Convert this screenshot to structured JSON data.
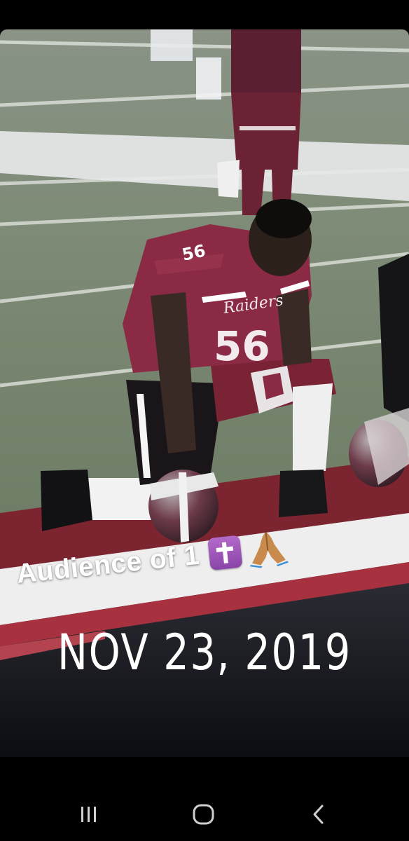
{
  "story": {
    "caption": "Audience of 1",
    "caption_emojis": [
      "latin-cross-emoji",
      "folded-hands-emoji"
    ],
    "date_sticker": "NOV 23, 2019",
    "photo": {
      "subject": "football-player-kneeling",
      "jersey_number": "56",
      "jersey_color": "#8a2a45"
    }
  },
  "nav_bar": {
    "buttons": [
      {
        "name": "recents",
        "icon": "recent-apps-icon"
      },
      {
        "name": "home",
        "icon": "home-icon"
      },
      {
        "name": "back",
        "icon": "back-icon"
      }
    ]
  }
}
